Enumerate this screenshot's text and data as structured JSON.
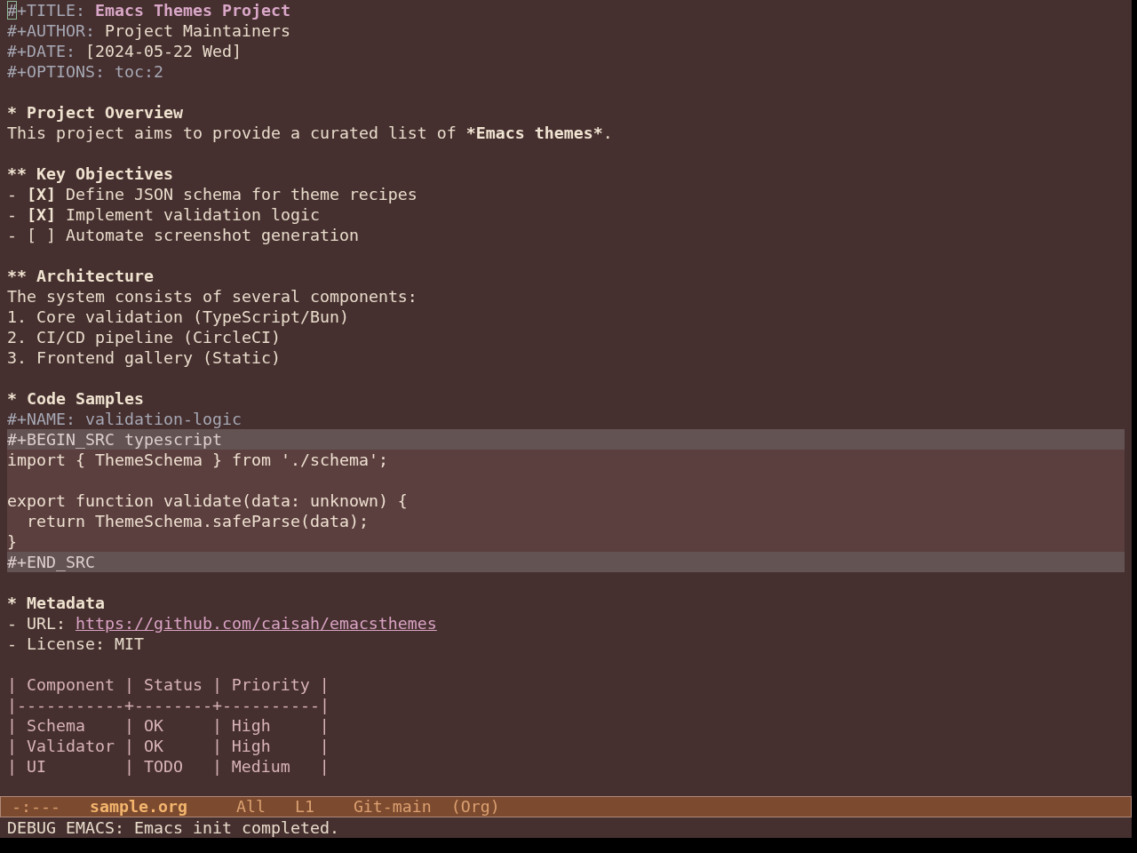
{
  "buffer": {
    "cursor_shown": true,
    "lines": [
      {
        "kind": "title",
        "key": "#+TITLE:",
        "value": "Emacs Themes Project"
      },
      {
        "kind": "keyword",
        "key": "#+AUTHOR:",
        "value": "Project Maintainers"
      },
      {
        "kind": "keyword",
        "key": "#+DATE:",
        "value": "[2024-05-22 Wed]"
      },
      {
        "kind": "meta",
        "text": "#+OPTIONS: toc:2"
      },
      {
        "kind": "blank"
      },
      {
        "kind": "heading",
        "text": "* Project Overview"
      },
      {
        "kind": "paragraph",
        "parts": [
          {
            "text": "This project aims to provide a curated list of ",
            "bold": false
          },
          {
            "text": "*Emacs themes*",
            "bold": true
          },
          {
            "text": ".",
            "bold": false
          }
        ]
      },
      {
        "kind": "blank"
      },
      {
        "kind": "heading",
        "text": "** Key Objectives"
      },
      {
        "kind": "checkbox",
        "bullet": "-",
        "box": "[X]",
        "checked": true,
        "text": "Define JSON schema for theme recipes"
      },
      {
        "kind": "checkbox",
        "bullet": "-",
        "box": "[X]",
        "checked": true,
        "text": "Implement validation logic"
      },
      {
        "kind": "checkbox",
        "bullet": "-",
        "box": "[ ]",
        "checked": false,
        "text": "Automate screenshot generation"
      },
      {
        "kind": "blank"
      },
      {
        "kind": "heading",
        "text": "** Architecture"
      },
      {
        "kind": "paragraph",
        "parts": [
          {
            "text": "The system consists of several components:",
            "bold": false
          }
        ]
      },
      {
        "kind": "list-item",
        "marker": "1.",
        "text": "Core validation (TypeScript/Bun)"
      },
      {
        "kind": "list-item",
        "marker": "2.",
        "text": "CI/CD pipeline (CircleCI)"
      },
      {
        "kind": "list-item",
        "marker": "3.",
        "text": "Frontend gallery (Static)"
      },
      {
        "kind": "blank"
      },
      {
        "kind": "heading",
        "text": "* Code Samples"
      },
      {
        "kind": "meta",
        "text": "#+NAME: validation-logic"
      },
      {
        "kind": "src-block",
        "begin": "#+BEGIN_SRC typescript",
        "code": [
          {
            "kind": "code",
            "text": "import { ThemeSchema } from './schema';"
          },
          {
            "kind": "blank"
          },
          {
            "kind": "code",
            "text": "export function validate(data: unknown) {"
          },
          {
            "kind": "code",
            "text": "  return ThemeSchema.safeParse(data);"
          },
          {
            "kind": "code",
            "text": "}"
          }
        ],
        "end": "#+END_SRC"
      },
      {
        "kind": "blank"
      },
      {
        "kind": "heading",
        "text": "* Metadata"
      },
      {
        "kind": "link-item",
        "marker": "-",
        "label": "URL:",
        "link": "https://github.com/caisah/emacsthemes"
      },
      {
        "kind": "list-item",
        "marker": "-",
        "text": "License: MIT"
      },
      {
        "kind": "blank"
      },
      {
        "kind": "table",
        "separator": "|",
        "columns": [
          "Component",
          "Status",
          "Priority"
        ],
        "rule": "|-----------+--------+----------|",
        "rows": [
          [
            "Schema",
            "OK",
            "High"
          ],
          [
            "Validator",
            "OK",
            "High"
          ],
          [
            "UI",
            "TODO",
            "Medium"
          ]
        ]
      }
    ]
  },
  "mode_line": {
    "status": "-:---",
    "buffer_name": "sample.org",
    "position": "All",
    "line": "L1",
    "vc": "Git-main",
    "mode": "(Org)"
  },
  "echo_area": {
    "message": "DEBUG EMACS: Emacs init completed."
  }
}
